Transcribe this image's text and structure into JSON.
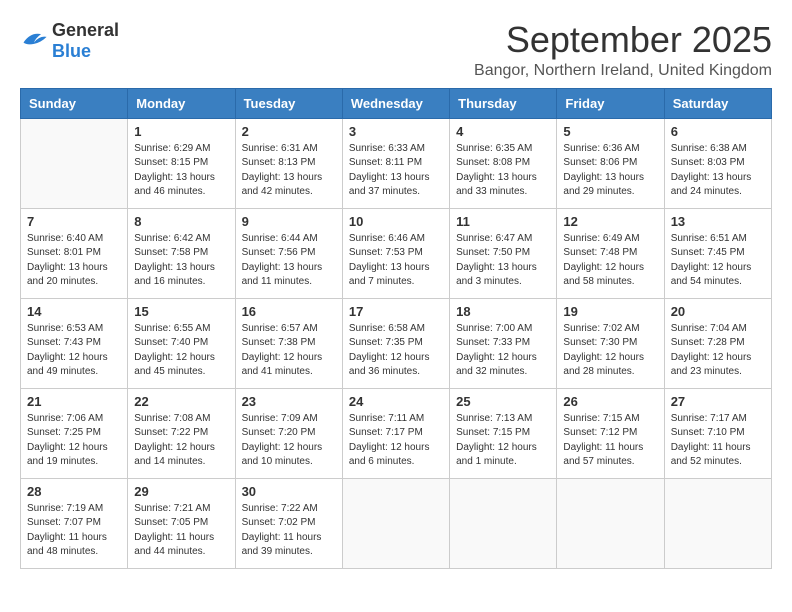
{
  "header": {
    "logo_general": "General",
    "logo_blue": "Blue",
    "month": "September 2025",
    "location": "Bangor, Northern Ireland, United Kingdom"
  },
  "weekdays": [
    "Sunday",
    "Monday",
    "Tuesday",
    "Wednesday",
    "Thursday",
    "Friday",
    "Saturday"
  ],
  "weeks": [
    [
      {
        "day": "",
        "info": ""
      },
      {
        "day": "1",
        "info": "Sunrise: 6:29 AM\nSunset: 8:15 PM\nDaylight: 13 hours\nand 46 minutes."
      },
      {
        "day": "2",
        "info": "Sunrise: 6:31 AM\nSunset: 8:13 PM\nDaylight: 13 hours\nand 42 minutes."
      },
      {
        "day": "3",
        "info": "Sunrise: 6:33 AM\nSunset: 8:11 PM\nDaylight: 13 hours\nand 37 minutes."
      },
      {
        "day": "4",
        "info": "Sunrise: 6:35 AM\nSunset: 8:08 PM\nDaylight: 13 hours\nand 33 minutes."
      },
      {
        "day": "5",
        "info": "Sunrise: 6:36 AM\nSunset: 8:06 PM\nDaylight: 13 hours\nand 29 minutes."
      },
      {
        "day": "6",
        "info": "Sunrise: 6:38 AM\nSunset: 8:03 PM\nDaylight: 13 hours\nand 24 minutes."
      }
    ],
    [
      {
        "day": "7",
        "info": "Sunrise: 6:40 AM\nSunset: 8:01 PM\nDaylight: 13 hours\nand 20 minutes."
      },
      {
        "day": "8",
        "info": "Sunrise: 6:42 AM\nSunset: 7:58 PM\nDaylight: 13 hours\nand 16 minutes."
      },
      {
        "day": "9",
        "info": "Sunrise: 6:44 AM\nSunset: 7:56 PM\nDaylight: 13 hours\nand 11 minutes."
      },
      {
        "day": "10",
        "info": "Sunrise: 6:46 AM\nSunset: 7:53 PM\nDaylight: 13 hours\nand 7 minutes."
      },
      {
        "day": "11",
        "info": "Sunrise: 6:47 AM\nSunset: 7:50 PM\nDaylight: 13 hours\nand 3 minutes."
      },
      {
        "day": "12",
        "info": "Sunrise: 6:49 AM\nSunset: 7:48 PM\nDaylight: 12 hours\nand 58 minutes."
      },
      {
        "day": "13",
        "info": "Sunrise: 6:51 AM\nSunset: 7:45 PM\nDaylight: 12 hours\nand 54 minutes."
      }
    ],
    [
      {
        "day": "14",
        "info": "Sunrise: 6:53 AM\nSunset: 7:43 PM\nDaylight: 12 hours\nand 49 minutes."
      },
      {
        "day": "15",
        "info": "Sunrise: 6:55 AM\nSunset: 7:40 PM\nDaylight: 12 hours\nand 45 minutes."
      },
      {
        "day": "16",
        "info": "Sunrise: 6:57 AM\nSunset: 7:38 PM\nDaylight: 12 hours\nand 41 minutes."
      },
      {
        "day": "17",
        "info": "Sunrise: 6:58 AM\nSunset: 7:35 PM\nDaylight: 12 hours\nand 36 minutes."
      },
      {
        "day": "18",
        "info": "Sunrise: 7:00 AM\nSunset: 7:33 PM\nDaylight: 12 hours\nand 32 minutes."
      },
      {
        "day": "19",
        "info": "Sunrise: 7:02 AM\nSunset: 7:30 PM\nDaylight: 12 hours\nand 28 minutes."
      },
      {
        "day": "20",
        "info": "Sunrise: 7:04 AM\nSunset: 7:28 PM\nDaylight: 12 hours\nand 23 minutes."
      }
    ],
    [
      {
        "day": "21",
        "info": "Sunrise: 7:06 AM\nSunset: 7:25 PM\nDaylight: 12 hours\nand 19 minutes."
      },
      {
        "day": "22",
        "info": "Sunrise: 7:08 AM\nSunset: 7:22 PM\nDaylight: 12 hours\nand 14 minutes."
      },
      {
        "day": "23",
        "info": "Sunrise: 7:09 AM\nSunset: 7:20 PM\nDaylight: 12 hours\nand 10 minutes."
      },
      {
        "day": "24",
        "info": "Sunrise: 7:11 AM\nSunset: 7:17 PM\nDaylight: 12 hours\nand 6 minutes."
      },
      {
        "day": "25",
        "info": "Sunrise: 7:13 AM\nSunset: 7:15 PM\nDaylight: 12 hours\nand 1 minute."
      },
      {
        "day": "26",
        "info": "Sunrise: 7:15 AM\nSunset: 7:12 PM\nDaylight: 11 hours\nand 57 minutes."
      },
      {
        "day": "27",
        "info": "Sunrise: 7:17 AM\nSunset: 7:10 PM\nDaylight: 11 hours\nand 52 minutes."
      }
    ],
    [
      {
        "day": "28",
        "info": "Sunrise: 7:19 AM\nSunset: 7:07 PM\nDaylight: 11 hours\nand 48 minutes."
      },
      {
        "day": "29",
        "info": "Sunrise: 7:21 AM\nSunset: 7:05 PM\nDaylight: 11 hours\nand 44 minutes."
      },
      {
        "day": "30",
        "info": "Sunrise: 7:22 AM\nSunset: 7:02 PM\nDaylight: 11 hours\nand 39 minutes."
      },
      {
        "day": "",
        "info": ""
      },
      {
        "day": "",
        "info": ""
      },
      {
        "day": "",
        "info": ""
      },
      {
        "day": "",
        "info": ""
      }
    ]
  ]
}
